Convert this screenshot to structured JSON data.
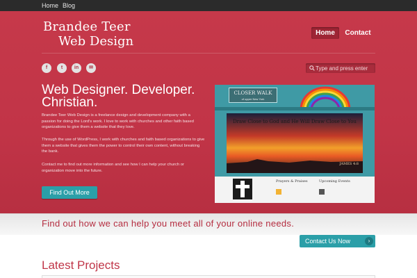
{
  "topbar": {
    "home": "Home",
    "blog": "Blog"
  },
  "logo": {
    "line1": "Brandee Teer",
    "line2": "Web Design"
  },
  "nav": {
    "home": "Home",
    "contact": "Contact"
  },
  "social": {
    "facebook": "f",
    "twitter": "t",
    "linkedin": "in",
    "email": "✉"
  },
  "search": {
    "placeholder": "Type and press enter"
  },
  "hero": {
    "headline": "Web Designer. Developer. Christian.",
    "para1": "Brandee Teer Web Design is a freelance design and development company with a passion for doing the Lord's work. I love to work with churches and other faith based organizations to give them a website that they love.",
    "para2": "Through the use of WordPress, I work with churches and faith based organizations to give them a website that gives them the power to control their own content, without breaking the bank.",
    "para3": "Contact me to find out more information and see how I can help your church or organization move into the future.",
    "cta": "Find Out More"
  },
  "screenshot": {
    "brand_line1": "CLOSER WALK",
    "brand_line2": "of upper New York",
    "banner_text": "Draw Close to God and He Will Draw Close to You",
    "verse": "JAMES 4:8",
    "col1_title": "Prayers & Praises",
    "col2_title": "Upcoming Events"
  },
  "band": {
    "text": "Find out how we can help you meet all of your online needs."
  },
  "contact_button": {
    "label": "Contact Us Now",
    "chevron": "›"
  },
  "latest": {
    "title": "Latest Projects"
  },
  "colors": {
    "brand_red": "#c13447",
    "teal": "#2b9fa8",
    "topbar": "#2b2b2b"
  }
}
